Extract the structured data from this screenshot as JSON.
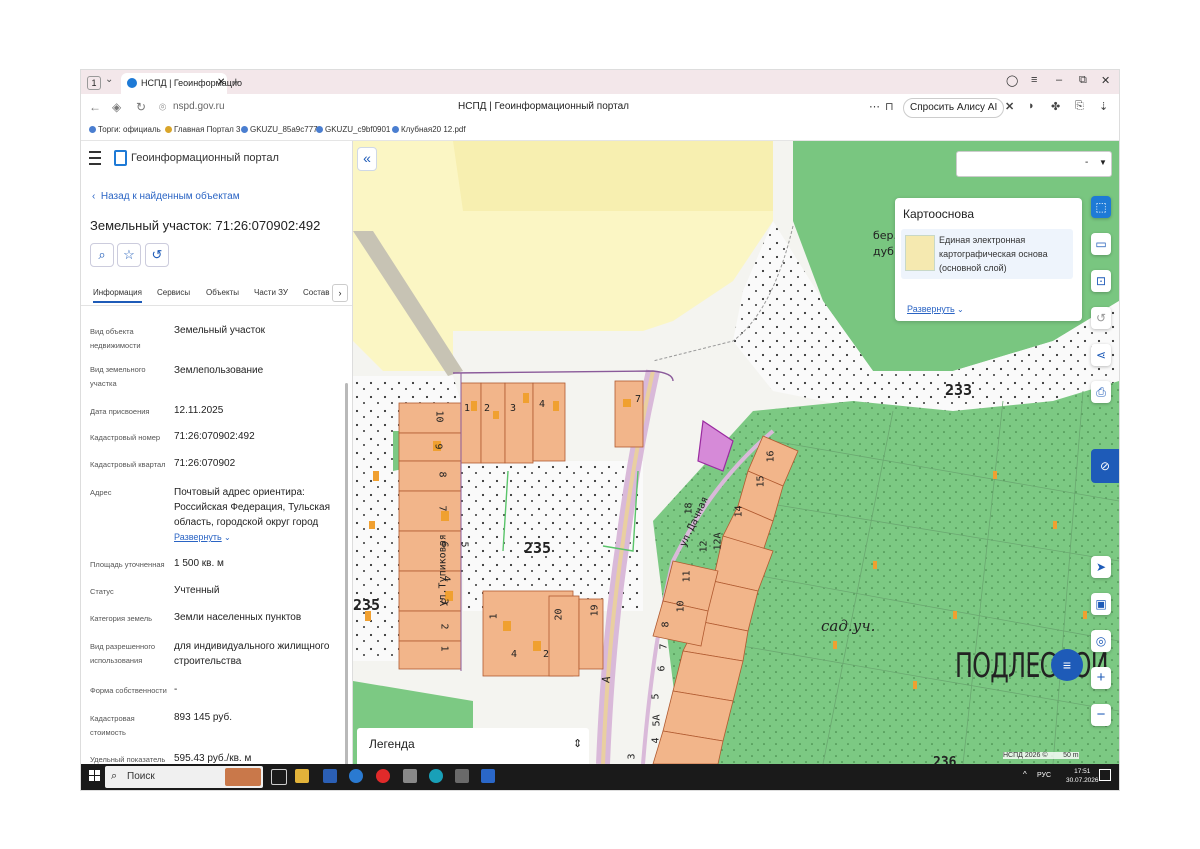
{
  "browser": {
    "tab_number": "1",
    "tab_title": "НСПД | Геоинформацио",
    "url": "nspd.gov.ru",
    "page_title": "НСПД | Геоинформационный портал",
    "alice_label": "Спросить Алису AI",
    "bookmarks": [
      "Торги: официаль",
      "Главная Портал 3",
      "GKUZU_85a9c777",
      "GKUZU_c9bf0901",
      "Клубная20 12.pdf"
    ]
  },
  "sidebar": {
    "portal_name": "Геоинформационный портал",
    "back_link": "Назад к найденным объектам",
    "title": "Земельный участок: 71:26:070902:492",
    "tabs": [
      "Информация",
      "Сервисы",
      "Объекты",
      "Части ЗУ",
      "Состав"
    ],
    "fields": [
      {
        "label": "Вид объекта недвижимости",
        "value": "Земельный участок"
      },
      {
        "label": "Вид земельного участка",
        "value": "Землепользование"
      },
      {
        "label": "Дата присвоения",
        "value": "12.11.2025"
      },
      {
        "label": "Кадастровый номер",
        "value": "71:26:070902:492"
      },
      {
        "label": "Кадастровый квартал",
        "value": "71:26:070902"
      },
      {
        "label": "Адрес",
        "value": "Почтовый адрес ориентира: Российская Федерация, Тульская область, городской округ город"
      },
      {
        "label": "Площадь уточненная",
        "value": "1 500 кв. м"
      },
      {
        "label": "Статус",
        "value": "Учтенный"
      },
      {
        "label": "Категория земель",
        "value": "Земли населенных пунктов"
      },
      {
        "label": "Вид разрешенного использования",
        "value": "для индивидуального жилищного строительства"
      },
      {
        "label": "Форма собственности",
        "value": "-"
      },
      {
        "label": "Кадастровая стоимость",
        "value": "893 145 руб."
      },
      {
        "label": "Удельный показатель",
        "value": "595.43 руб./кв. м"
      }
    ],
    "address_expand": "Развернуть"
  },
  "map": {
    "dropdown_value": "-",
    "layer_panel": {
      "title": "Картооснова",
      "layer_name": "Единая электронная картографическая основа (основной слой)",
      "expand": "Развернуть"
    },
    "legend_title": "Легенда",
    "scale_text": "НСПД 2026 ©",
    "scale_bar": "50 m",
    "labels": {
      "block_233": "233",
      "block_235": "235",
      "block_235_left": "235",
      "block_236": "236",
      "village": "ПОДЛЕСНОЙ",
      "garden": "сад.уч.",
      "river_top": "бер.",
      "river_bottom": "дуб",
      "street_ulitsa": "ул.Тупиковая",
      "street_dachnaya": "ул.Дачная",
      "road_letter": "A"
    },
    "lot_numbers": [
      "1",
      "2",
      "3",
      "4",
      "7",
      "10",
      "9",
      "8",
      "7",
      "6",
      "5",
      "4",
      "3",
      "2",
      "1",
      "18",
      "16",
      "15",
      "14",
      "12",
      "12A",
      "11",
      "10",
      "8",
      "7",
      "6",
      "5",
      "5A",
      "4",
      "3",
      "20",
      "19",
      "2",
      "4",
      "1"
    ]
  },
  "taskbar": {
    "search_placeholder": "Поиск",
    "language": "РУС",
    "time": "17:51",
    "date": "30.07.2026"
  }
}
